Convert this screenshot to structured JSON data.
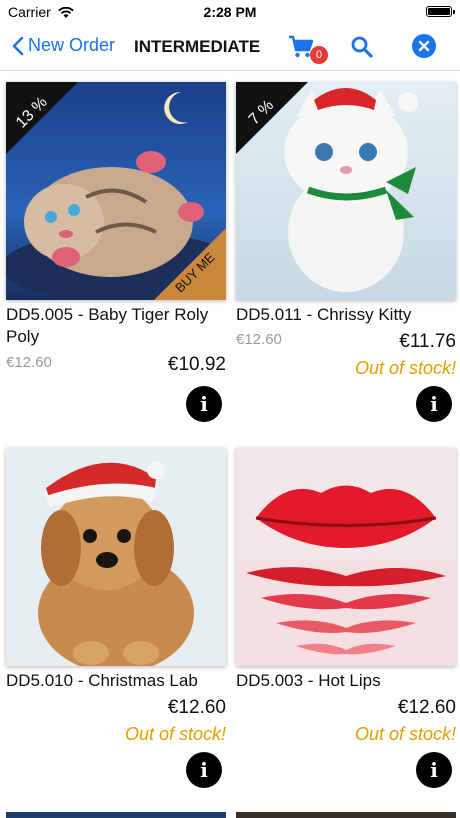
{
  "status_bar": {
    "carrier": "Carrier",
    "time": "2:28 PM"
  },
  "nav": {
    "back_label": "New Order",
    "title": "INTERMEDIATE",
    "cart_count": "0"
  },
  "products": [
    {
      "name": "DD5.005 - Baby Tiger Roly Poly",
      "old_price": "€12.60",
      "price": "€10.92",
      "discount": "13 %",
      "ribbon": "BUY ME",
      "stock": ""
    },
    {
      "name": "DD5.011 - Chrissy Kitty",
      "old_price": "€12.60",
      "price": "€11.76",
      "discount": "7 %",
      "ribbon": "",
      "stock": "Out of stock!"
    },
    {
      "name": "DD5.010 - Christmas Lab",
      "old_price": "",
      "price": "€12.60",
      "discount": "",
      "ribbon": "",
      "stock": "Out of stock!"
    },
    {
      "name": "DD5.003 - Hot Lips",
      "old_price": "",
      "price": "€12.60",
      "discount": "",
      "ribbon": "",
      "stock": "Out of stock!"
    }
  ],
  "icons": {
    "info": "info-icon",
    "cart": "cart-icon",
    "search": "search-icon",
    "close": "close-icon",
    "back": "chevron-left-icon"
  }
}
